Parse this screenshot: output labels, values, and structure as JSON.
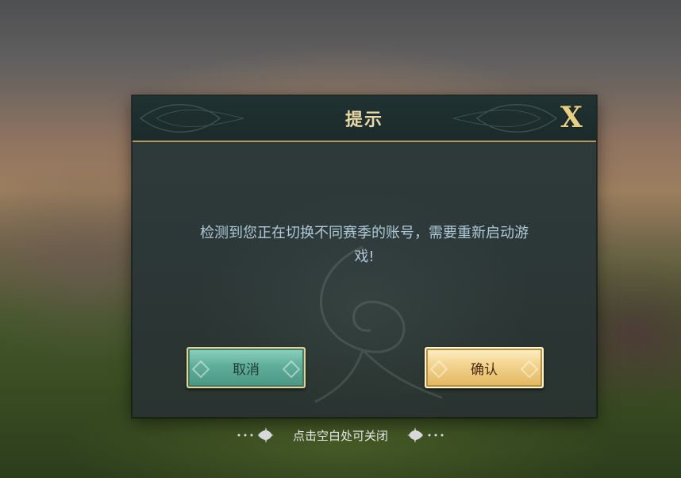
{
  "dialog": {
    "title": "提示",
    "close_label": "X",
    "message_line1": "检测到您正在切换不同赛季的账号，需要重新启动游",
    "message_line2": "戏!",
    "cancel_label": "取消",
    "confirm_label": "确认"
  },
  "hint": {
    "text": "点击空白处可关闭"
  },
  "colors": {
    "title": "#e9d9a6",
    "message": "#aec9d8",
    "cancel_button": "#5fae9a",
    "confirm_button": "#f3d592",
    "header_border": "#b09a5e"
  }
}
